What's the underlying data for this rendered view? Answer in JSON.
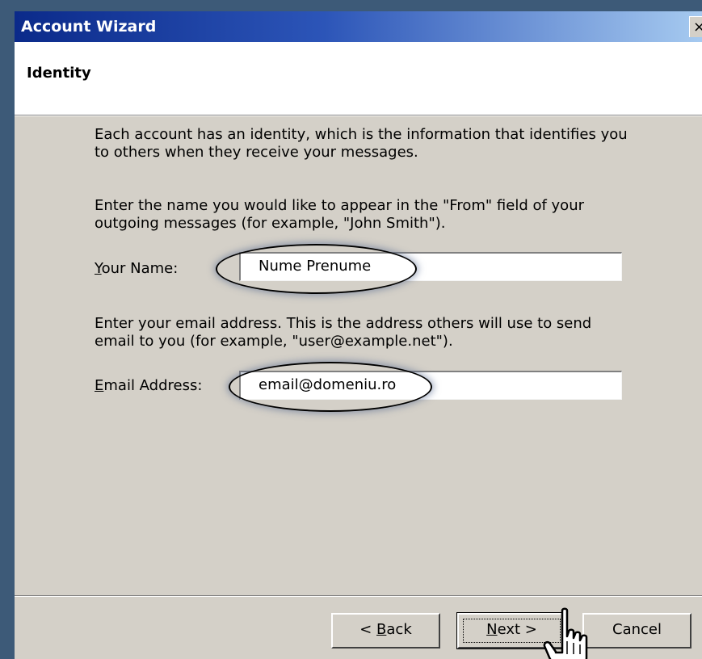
{
  "window": {
    "title": "Account Wizard",
    "close_glyph": "×"
  },
  "header": {
    "title": "Identity"
  },
  "body": {
    "intro_text": "Each account has an identity, which is the information that identifies you to others when they receive your messages.",
    "name_instructions": "Enter the name you would like to appear in the \"From\" field of your outgoing messages (for example, \"John Smith\").",
    "name_label_underlined": "Y",
    "name_label_rest": "our Name:",
    "name_value": "Nume Prenume",
    "email_instructions": "Enter your email address. This is the address others will use to send email to you (for example, \"user@example.net\").",
    "email_label_underlined": "E",
    "email_label_rest": "mail Address:",
    "email_value": "email@domeniu.ro"
  },
  "buttons": {
    "back_prefix": "< ",
    "back_underlined": "B",
    "back_rest": "ack",
    "next_underlined": "N",
    "next_rest": "ext >",
    "cancel": "Cancel"
  },
  "icons": {
    "cursor": "hand-pointer-icon",
    "close": "close-icon"
  }
}
